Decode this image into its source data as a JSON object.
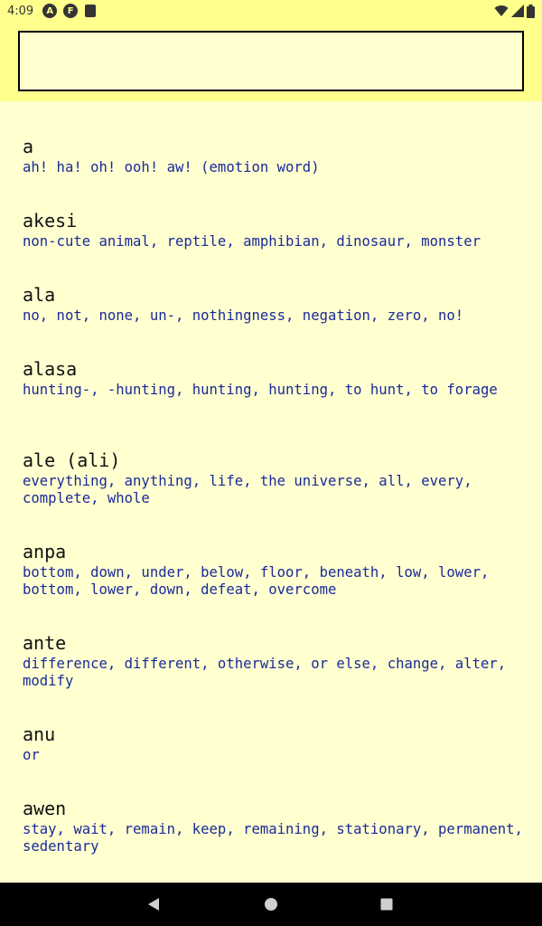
{
  "status_bar": {
    "time": "4:09",
    "notification_icons": [
      "A",
      "F"
    ],
    "icons": [
      "android-icon",
      "f-icon",
      "sd-card-icon",
      "wifi-icon",
      "signal-icon",
      "battery-icon"
    ]
  },
  "search": {
    "value": "",
    "placeholder": ""
  },
  "entries": [
    {
      "word": "a",
      "definition": "ah! ha! oh! ooh! aw! (emotion word)"
    },
    {
      "word": "akesi",
      "definition": "non-cute animal, reptile, amphibian, dinosaur, monster"
    },
    {
      "word": "ala",
      "definition": "no, not, none, un-, nothingness, negation, zero, no!"
    },
    {
      "word": "alasa",
      "definition": "hunting-, -hunting, hunting, hunting, to hunt, to forage"
    },
    {
      "word": "ale (ali)",
      "definition": "everything, anything, life, the universe, all, every, complete, whole"
    },
    {
      "word": "anpa",
      "definition": "bottom, down, under, below, floor, beneath, low, lower, bottom, lower, down, defeat, overcome"
    },
    {
      "word": "ante",
      "definition": "difference, different, otherwise, or else, change, alter, modify"
    },
    {
      "word": "anu",
      "definition": "or"
    },
    {
      "word": "awen",
      "definition": "stay, wait, remain, keep, remaining, stationary, permanent, sedentary"
    }
  ],
  "colors": {
    "header_background": "#FFFF8D",
    "page_background": "#FFFFD0",
    "definition_text": "#1a2a9a",
    "nav_bar": "#000000"
  }
}
